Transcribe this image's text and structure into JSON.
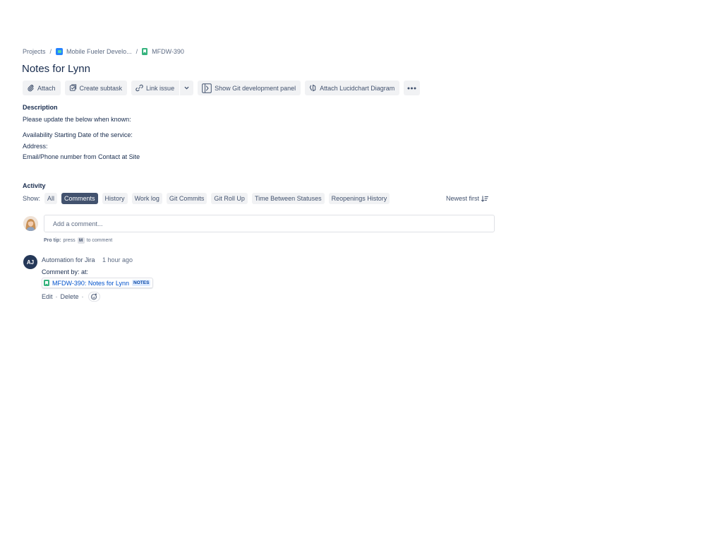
{
  "breadcrumb": {
    "projects": "Projects",
    "project_name": "Mobile Fueler Develo...",
    "issue_key": "MFDW-390"
  },
  "issue": {
    "title": "Notes for Lynn"
  },
  "toolbar": {
    "attach": "Attach",
    "create_subtask": "Create subtask",
    "link_issue": "Link issue",
    "show_git": "Show Git development panel",
    "attach_lucid": "Attach Lucidchart Diagram"
  },
  "description": {
    "heading": "Description",
    "line1": "Please update the below when known:",
    "line2": "Availability Starting Date of the service:",
    "line3": "Address:",
    "line4": "Email/Phone number from Contact at Site"
  },
  "activity": {
    "heading": "Activity",
    "show_label": "Show:",
    "filters": [
      "All",
      "Comments",
      "History",
      "Work log",
      "Git Commits",
      "Git Roll Up",
      "Time Between Statuses",
      "Reopenings History"
    ],
    "active_filter": "Comments",
    "sort_label": "Newest first"
  },
  "comment_input": {
    "placeholder": "Add a comment...",
    "protip_bold": "Pro tip:",
    "protip_press": "press",
    "protip_key": "M",
    "protip_suffix": "to comment"
  },
  "comment": {
    "avatar_initials": "AJ",
    "author": "Automation for Jira",
    "time": "1 hour ago",
    "text": "Comment by:  at:",
    "issue_link": "MFDW-390: Notes for Lynn",
    "issue_lozenge": "NOTES",
    "edit": "Edit",
    "delete": "Delete",
    "separator": "·"
  },
  "colors": {
    "text_primary": "#172b4d",
    "text_secondary": "#42526e",
    "link": "#0052cc",
    "active_chip": "#42526e",
    "button_bg": "#f1f2f4",
    "story_green": "#36b37e"
  }
}
